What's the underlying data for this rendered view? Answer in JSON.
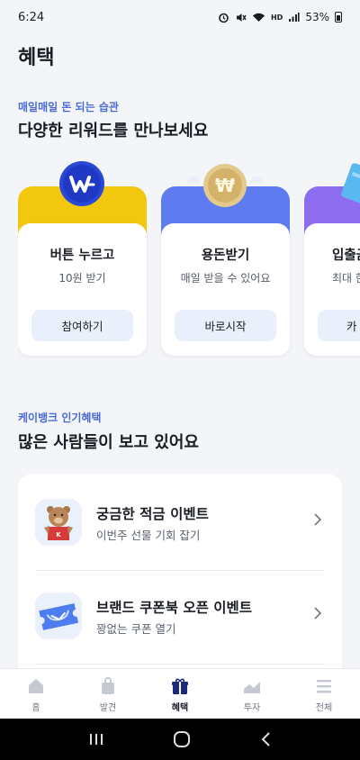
{
  "status": {
    "time": "6:24",
    "battery": "53%",
    "network": "HD",
    "icons": [
      "alarm-icon",
      "mute-icon",
      "wifi-icon",
      "signal-icon",
      "battery-icon"
    ]
  },
  "page": {
    "title": "혜택"
  },
  "rewards_section": {
    "eyebrow": "매일매일 돈 되는 습관",
    "heading": "다양한 리워드를 만나보세요",
    "cards": [
      {
        "title": "버튼 누르고",
        "subtitle": "10원 받기",
        "button": "참여하기",
        "color": "#f2c80f",
        "icon": "w-coin-icon"
      },
      {
        "title": "용돈받기",
        "subtitle": "매일 받을 수 있어요",
        "button": "바로시작",
        "color": "#5e7bf0",
        "icon": "winged-coin-icon"
      },
      {
        "title": "입출금",
        "subtitle": "최대 한",
        "button": "카",
        "color": "#8e6cf0",
        "icon": "card-icon"
      }
    ]
  },
  "popular_section": {
    "eyebrow": "케이뱅크 인기혜택",
    "heading": "많은 사람들이 보고 있어요",
    "items": [
      {
        "title": "궁금한 적금 이벤트",
        "subtitle": "이번주 선물 기회 잡기",
        "icon": "bear-mascot-icon"
      },
      {
        "title": "브랜드 쿠폰북 오픈 이벤트",
        "subtitle": "꽝없는 쿠폰 열기",
        "icon": "coupon-ticket-icon"
      }
    ]
  },
  "bottom_nav": {
    "items": [
      {
        "label": "홈",
        "icon": "home-icon",
        "active": false
      },
      {
        "label": "발견",
        "icon": "shopping-bag-icon",
        "active": false
      },
      {
        "label": "혜택",
        "icon": "gift-icon",
        "active": true
      },
      {
        "label": "투자",
        "icon": "chart-icon",
        "active": false
      },
      {
        "label": "전체",
        "icon": "menu-icon",
        "active": false
      }
    ]
  },
  "colors": {
    "accent": "#4a6bd6",
    "background": "#f3f5f9",
    "active_nav": "#1b2a7a"
  }
}
